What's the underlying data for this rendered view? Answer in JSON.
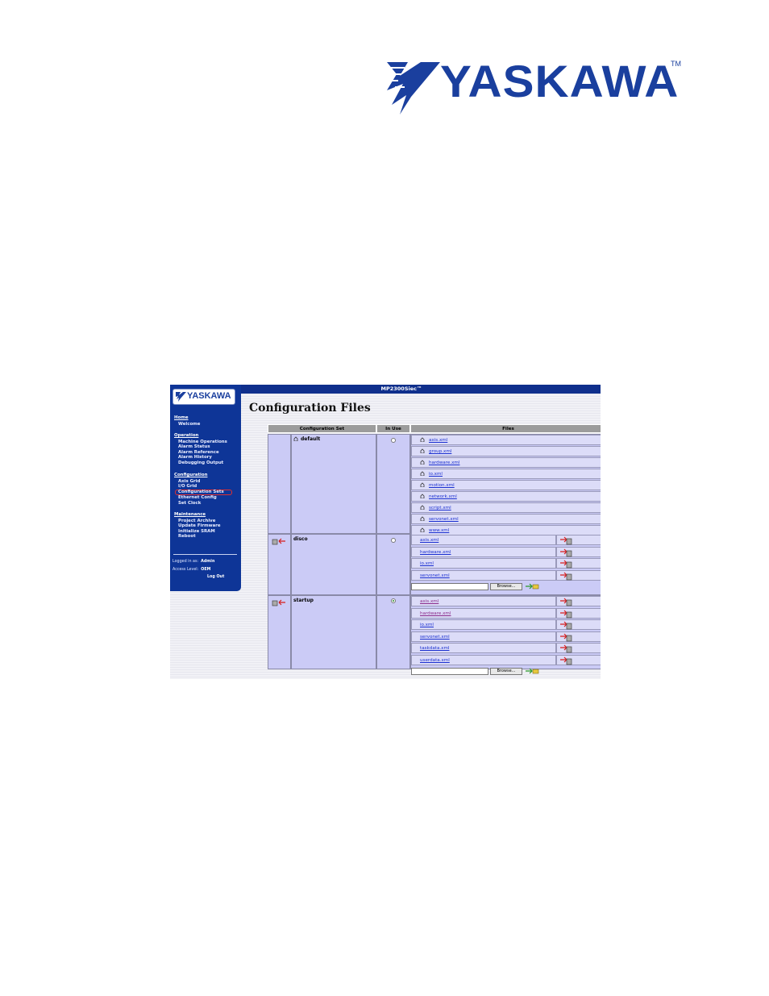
{
  "brand": {
    "name": "YASKAWA",
    "trademark": "TM"
  },
  "screenshot": {
    "window_title": "MP2300Siec™",
    "logo_text": "YASKAWA",
    "page_title": "Configuration Files",
    "nav": [
      {
        "heading": "Home",
        "items": [
          "Welcome"
        ]
      },
      {
        "heading": "Operation",
        "items": [
          "Machine Operations",
          "Alarm Status",
          "Alarm Reference",
          "Alarm History",
          "Debugging Output"
        ]
      },
      {
        "heading": "Configuration",
        "items": [
          "Axis Grid",
          "I/O Grid",
          "Configuration Sets",
          "Ethernet Config",
          "Set Clock"
        ]
      },
      {
        "heading": "Maintenance",
        "items": [
          "Project Archive",
          "Update Firmware",
          "Initialize SRAM",
          "Reboot"
        ]
      }
    ],
    "selected_nav": "Configuration Sets",
    "login": {
      "logged_in_label": "Logged in as:",
      "user": "Admin",
      "access_label": "Access Level:",
      "access": "OEM",
      "logout": "Log Out"
    },
    "table": {
      "headers": [
        "Configuration Set",
        "In Use",
        "Files"
      ],
      "sets": [
        {
          "name": "default",
          "in_use": false,
          "files": [
            "axis.xml",
            "group.xml",
            "hardware.xml",
            "io.xml",
            "motion.xml",
            "network.xml",
            "script.xml",
            "servonet.xml",
            "www.xml"
          ]
        },
        {
          "name": "disco",
          "in_use": false,
          "files": [
            "axis.xml",
            "hardware.xml",
            "io.xml",
            "servonet.xml"
          ],
          "browse_label": "Browse..."
        },
        {
          "name": "startup",
          "in_use": true,
          "files": [
            "axis.xml",
            "hardware.xml",
            "io.xml",
            "servonet.xml",
            "taskdata.xml",
            "userdata.xml"
          ],
          "browse_label": "Browse..."
        }
      ]
    }
  },
  "colors": {
    "brand_blue": "#1a3f9e",
    "sidebar": "#0e3597",
    "table_cell": "#cbcbf6",
    "link": "#1a2fd0",
    "delete_arrow": "#d81c1c"
  }
}
